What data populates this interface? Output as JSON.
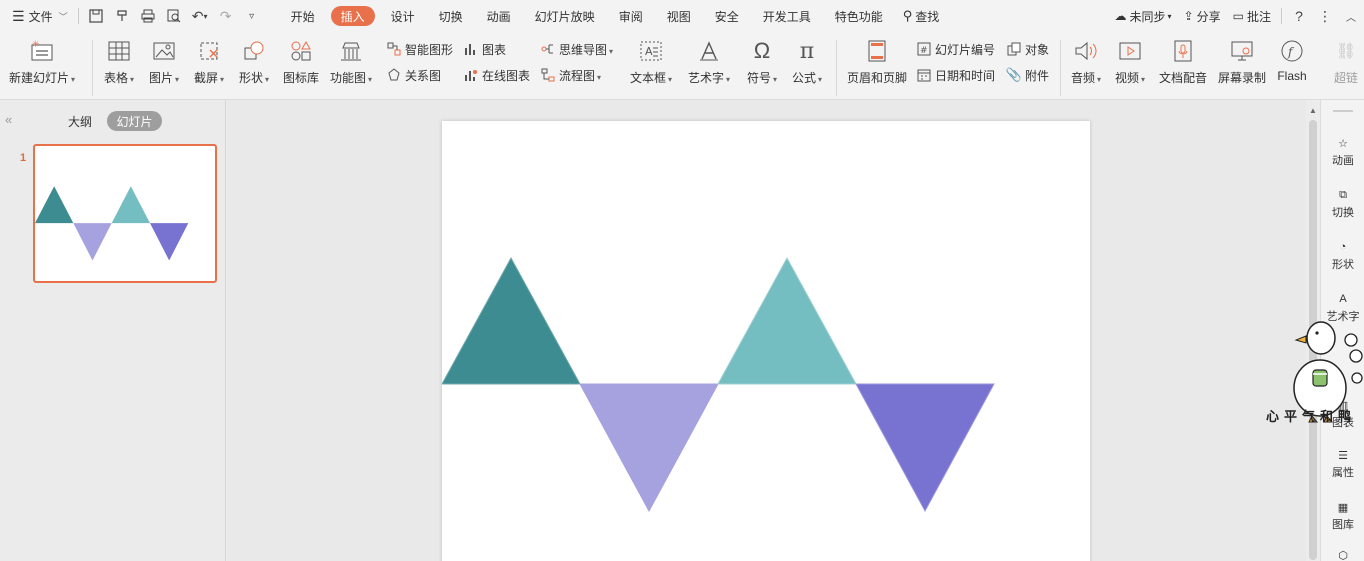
{
  "menubar": {
    "file_label": "文件",
    "tabs": [
      "开始",
      "插入",
      "设计",
      "切换",
      "动画",
      "幻灯片放映",
      "审阅",
      "视图",
      "安全",
      "开发工具",
      "特色功能"
    ],
    "active_tab": "插入",
    "search_label": "查找",
    "sync_label": "未同步",
    "share_label": "分享",
    "comment_label": "批注"
  },
  "ribbon": {
    "new_slide": "新建幻灯片",
    "table": "表格",
    "picture": "图片",
    "screenshot": "截屏",
    "shape": "形状",
    "icon_lib": "图标库",
    "func_chart": "功能图",
    "smart_art": "智能图形",
    "chart": "图表",
    "relation_chart": "关系图",
    "online_chart": "在线图表",
    "mind_map": "思维导图",
    "flow_chart": "流程图",
    "text_box": "文本框",
    "word_art": "艺术字",
    "symbol": "符号",
    "formula": "公式",
    "header_footer": "页眉和页脚",
    "slide_number": "幻灯片编号",
    "object": "对象",
    "date_time": "日期和时间",
    "attachment": "附件",
    "audio": "音频",
    "video": "视频",
    "doc_dub": "文档配音",
    "screen_rec": "屏幕录制",
    "flash": "Flash",
    "super_link": "超链"
  },
  "left_panel": {
    "outline_tab": "大纲",
    "slides_tab": "幻灯片",
    "slide_number": "1"
  },
  "right_sidebar": {
    "items": [
      "动画",
      "切换",
      "形状",
      "艺术字",
      "属性",
      "图库"
    ],
    "partial_items": [
      "图表"
    ]
  },
  "slide": {
    "triangles": [
      {
        "direction": "up",
        "color": "#3d8c91"
      },
      {
        "direction": "down",
        "color": "#a6a2e0"
      },
      {
        "direction": "up",
        "color": "#74bec2"
      },
      {
        "direction": "down",
        "color": "#7873d0"
      }
    ]
  },
  "watermark": {
    "text": "心平气和鸭"
  }
}
